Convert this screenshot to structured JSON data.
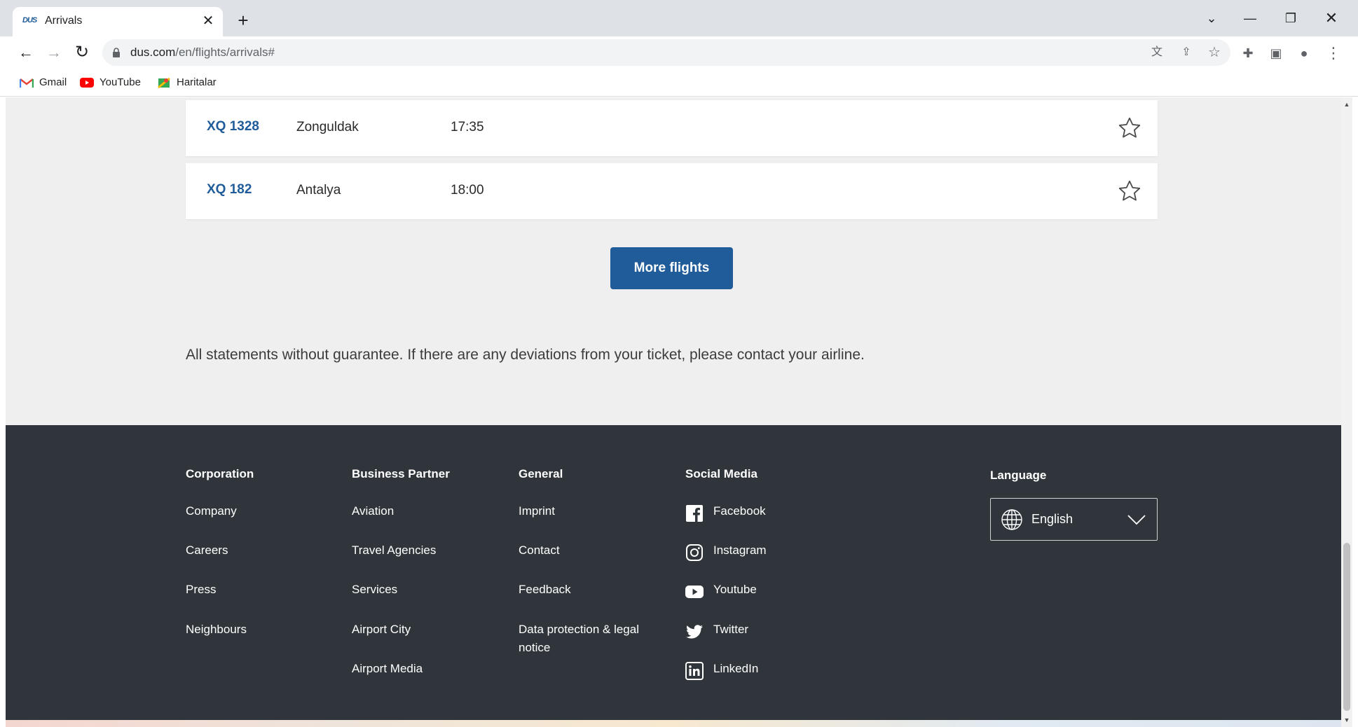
{
  "browser": {
    "tab_title": "Arrivals",
    "tab_favicon_text": "DUS",
    "url_domain": "dus.com",
    "url_path": "/en/flights/arrivals#",
    "bookmarks": [
      {
        "label": "Gmail",
        "icon": "gmail-icon"
      },
      {
        "label": "YouTube",
        "icon": "youtube-icon"
      },
      {
        "label": "Haritalar",
        "icon": "maps-icon"
      }
    ]
  },
  "flights": [
    {
      "number": "XQ 1328",
      "city": "Zonguldak",
      "time": "17:35"
    },
    {
      "number": "XQ 182",
      "city": "Antalya",
      "time": "18:00"
    }
  ],
  "more_flights_label": "More flights",
  "disclaimer": "All statements without guarantee. If there are any deviations from your ticket, please contact your airline.",
  "footer": {
    "columns": [
      {
        "heading": "Corporation",
        "links": [
          "Company",
          "Careers",
          "Press",
          "Neighbours"
        ]
      },
      {
        "heading": "Business Partner",
        "links": [
          "Aviation",
          "Travel Agencies",
          "Services",
          "Airport City",
          "Airport Media"
        ]
      },
      {
        "heading": "General",
        "links": [
          "Imprint",
          "Contact",
          "Feedback",
          "Data protection & legal notice"
        ]
      },
      {
        "heading": "Social Media",
        "links": [
          "Facebook",
          "Instagram",
          "Youtube",
          "Twitter",
          "LinkedIn"
        ]
      }
    ],
    "language_heading": "Language",
    "language_value": "English"
  },
  "colors": {
    "accent": "#1f5c99",
    "footer_bg": "#2f353a",
    "page_bg": "#efefef"
  }
}
